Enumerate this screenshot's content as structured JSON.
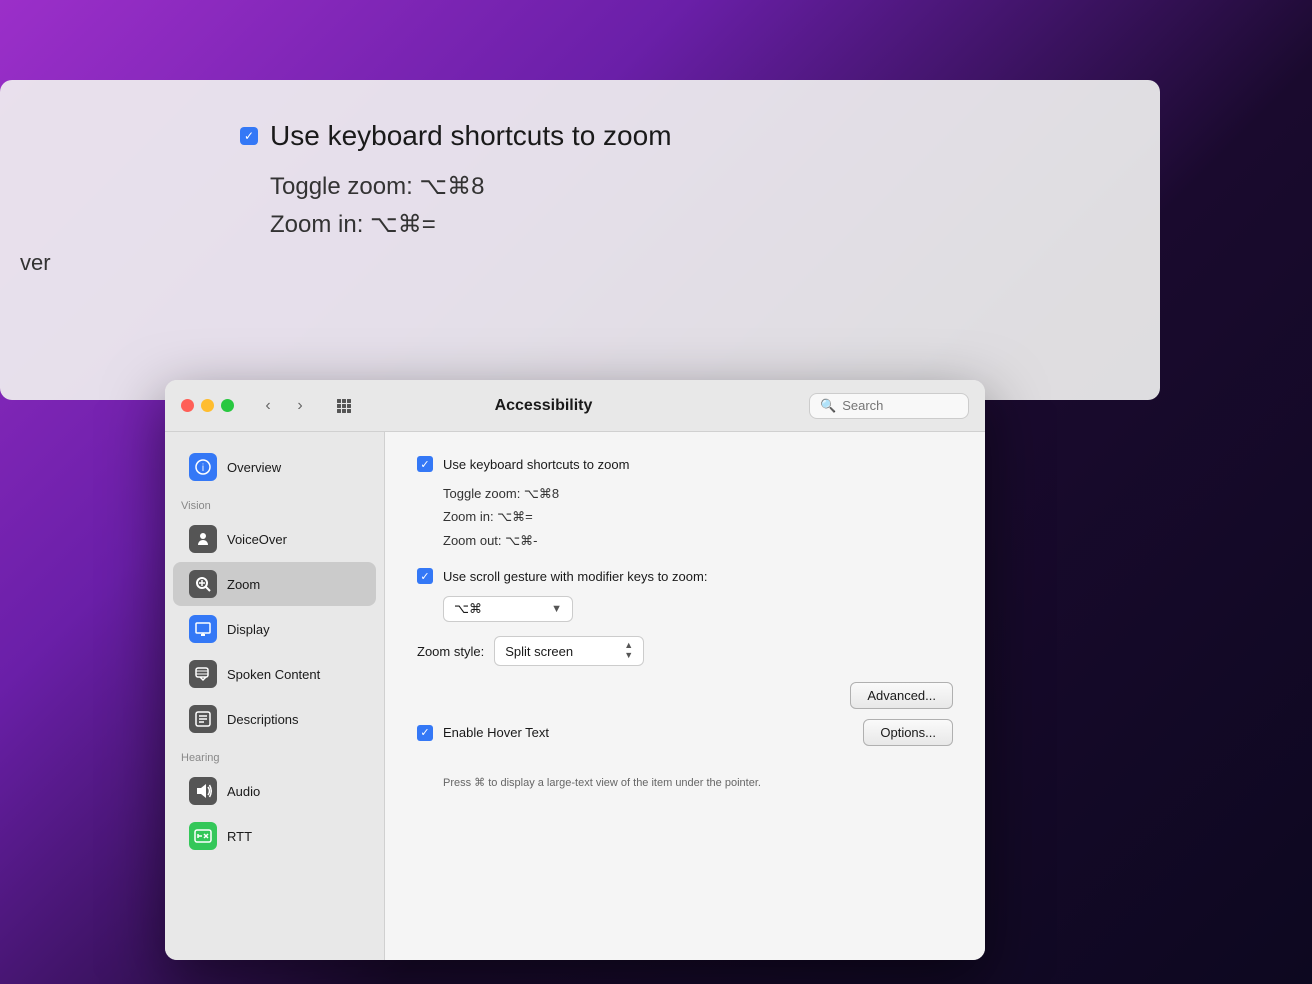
{
  "desktop": {
    "bg_color": "#1a0a2e"
  },
  "behind_window": {
    "checkbox_checked": true,
    "title": "Use keyboard shortcuts to zoom",
    "toggle_zoom": "Toggle zoom:  ⌥⌘8",
    "zoom_in": "Zoom in:  ⌥⌘=",
    "nav_label": "ver"
  },
  "main_window": {
    "title": "Accessibility",
    "search_placeholder": "Search",
    "traffic_lights": [
      "red",
      "yellow",
      "green"
    ],
    "sidebar": {
      "items": [
        {
          "id": "overview",
          "label": "Overview",
          "icon": "ⓘ",
          "icon_class": "icon-overview"
        },
        {
          "id": "voiceover",
          "label": "VoiceOver",
          "icon": "♿",
          "icon_class": "icon-voiceover",
          "section": "Vision"
        },
        {
          "id": "zoom",
          "label": "Zoom",
          "icon": "🔍",
          "icon_class": "icon-zoom",
          "active": true
        },
        {
          "id": "display",
          "label": "Display",
          "icon": "▬",
          "icon_class": "icon-display"
        },
        {
          "id": "spoken-content",
          "label": "Spoken Content",
          "icon": "💬",
          "icon_class": "icon-spoken"
        },
        {
          "id": "descriptions",
          "label": "Descriptions",
          "icon": "⬜",
          "icon_class": "icon-descriptions"
        },
        {
          "id": "audio",
          "label": "Audio",
          "icon": "🔊",
          "icon_class": "icon-audio",
          "section": "Hearing"
        },
        {
          "id": "rtt",
          "label": "RTT",
          "icon": "⌨",
          "icon_class": "icon-rtt"
        }
      ]
    },
    "content": {
      "keyboard_shortcuts_checked": true,
      "keyboard_shortcuts_label": "Use keyboard shortcuts to zoom",
      "toggle_zoom": "Toggle zoom:  ⌥⌘8",
      "zoom_in": "Zoom in:  ⌥⌘=",
      "zoom_out": "Zoom out:  ⌥⌘-",
      "scroll_gesture_checked": true,
      "scroll_gesture_label": "Use scroll gesture with modifier keys to zoom:",
      "modifier_key": "⌥⌘",
      "zoom_style_label": "Zoom style:",
      "zoom_style_value": "Split screen",
      "advanced_button": "Advanced...",
      "hover_text_checked": true,
      "hover_text_label": "Enable Hover Text",
      "options_button": "Options...",
      "hover_text_description": "Press ⌘ to display a large-text view of the item under the pointer."
    }
  }
}
